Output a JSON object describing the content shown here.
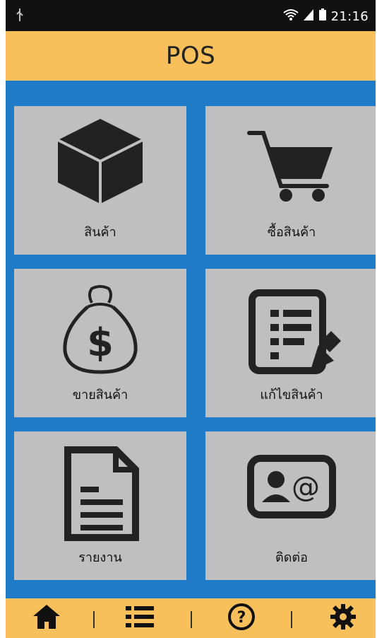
{
  "status": {
    "time": "21:16"
  },
  "header": {
    "title": "POS"
  },
  "tiles": [
    {
      "label": "สินค้า",
      "icon": "box-icon"
    },
    {
      "label": "ซื้อสินค้า",
      "icon": "cart-icon"
    },
    {
      "label": "ขายสินค้า",
      "icon": "money-bag-icon"
    },
    {
      "label": "แก้ไขสินค้า",
      "icon": "edit-list-icon"
    },
    {
      "label": "รายงาน",
      "icon": "document-icon"
    },
    {
      "label": "ติดต่อ",
      "icon": "contact-card-icon"
    }
  ],
  "bottom_nav": [
    {
      "icon": "home-icon"
    },
    {
      "icon": "list-icon"
    },
    {
      "icon": "help-icon"
    },
    {
      "icon": "settings-icon"
    }
  ],
  "colors": {
    "header_bg": "#f7c05a",
    "app_bg": "#1f7bc8",
    "tile_bg": "#bfbfbf",
    "statusbar_bg": "#111111"
  }
}
